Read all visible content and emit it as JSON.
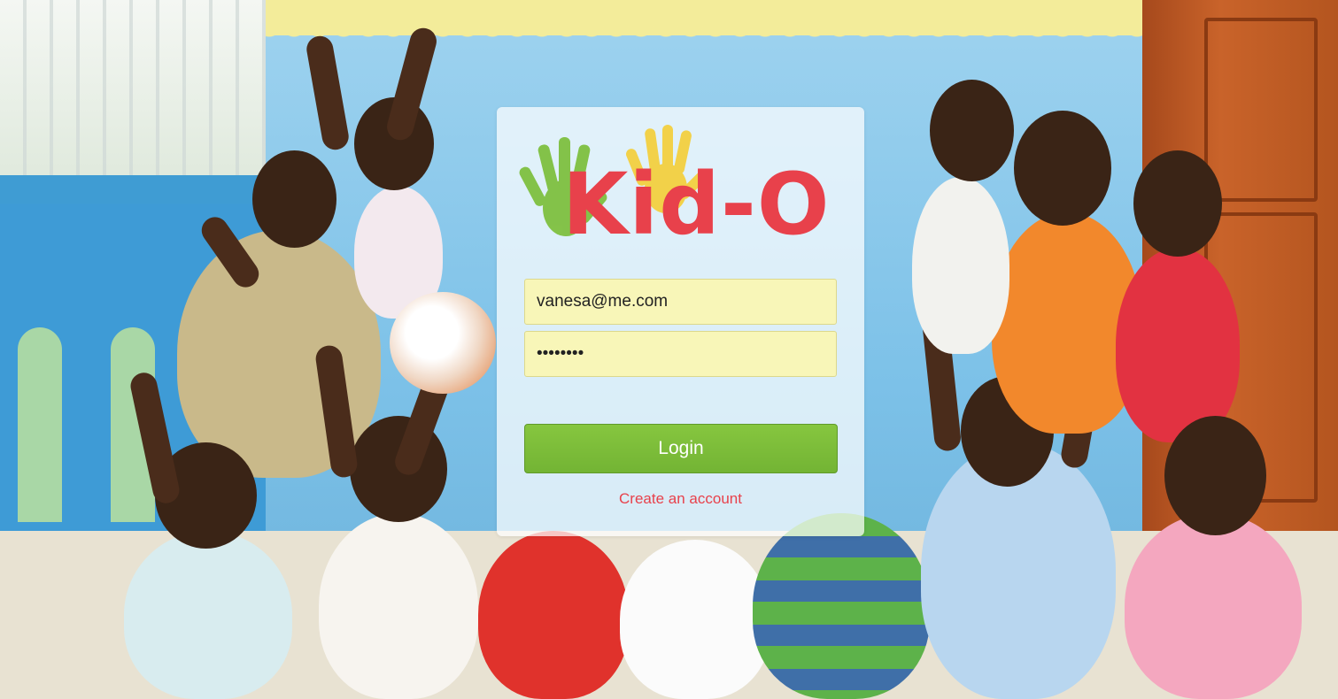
{
  "brand": {
    "name": "Kid-O",
    "color": "#e8414b",
    "logo_hand_colors": [
      "#7cbf3a",
      "#f4cf3a"
    ]
  },
  "login_form": {
    "email_value": "vanesa@me.com",
    "password_value": "••••••••",
    "login_label": "Login",
    "create_account_label": "Create an account",
    "field_color": "#f8f6b8",
    "button_color": "#7bbd38"
  },
  "background": {
    "description_icon": "photo-background"
  }
}
